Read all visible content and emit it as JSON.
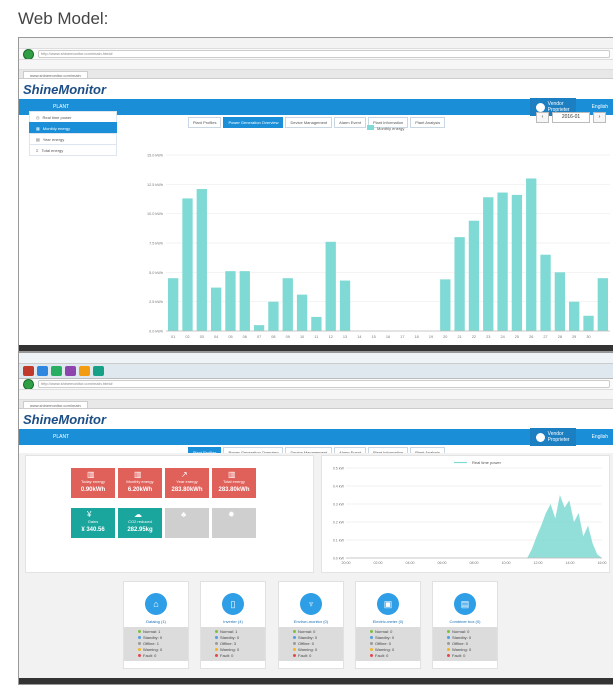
{
  "heading": "Web Model:",
  "colors": {
    "accent": "#1a8fd8",
    "bar": "#7fd9d4",
    "tile_red": "#e0605a",
    "tile_teal": "#1aa59d",
    "tile_gray": "#cfcfcf",
    "normal": "#7fbf3f",
    "standby": "#4e9ee0",
    "offline": "#9a9a9a",
    "warning": "#f0b429",
    "fault": "#e04a4a"
  },
  "brand": {
    "logo": "ShineMonitor",
    "plant": "PLANT",
    "user_line1": "Vendor",
    "user_line2": "Proprieter",
    "lang": "English"
  },
  "browser": {
    "url": "http://www.shinemonitor.com/main.html#",
    "tab": "www.shinemonitor.com/main"
  },
  "nav_tabs": [
    "Plant Profiles",
    "Power Generation Overview",
    "Device Management",
    "Alarm Event",
    "Plant Information",
    "Plant Analysis"
  ],
  "sidebar": [
    {
      "label": "Real time power",
      "icon": "clock-icon"
    },
    {
      "label": "Monthly energy",
      "icon": "calendar-icon"
    },
    {
      "label": "Year energy",
      "icon": "chart-icon"
    },
    {
      "label": "Total energy",
      "icon": "sum-icon"
    }
  ],
  "date_value": "2016-01",
  "chart_data": [
    {
      "type": "bar",
      "legend": "Monthly energy",
      "categories": [
        "01",
        "02",
        "03",
        "04",
        "05",
        "06",
        "07",
        "08",
        "09",
        "10",
        "11",
        "12",
        "13",
        "14",
        "15",
        "16",
        "17",
        "18",
        "19",
        "20",
        "21",
        "22",
        "23",
        "24",
        "25",
        "26",
        "27",
        "28",
        "29",
        "30"
      ],
      "values": [
        4.5,
        11.3,
        12.1,
        3.7,
        5.1,
        5.1,
        0.5,
        2.5,
        4.5,
        3.1,
        1.2,
        7.6,
        4.3,
        0.0,
        0.0,
        0.0,
        0.0,
        0.0,
        0.0,
        4.4,
        8.0,
        9.4,
        11.4,
        11.8,
        11.6,
        13.0,
        6.5,
        5.0,
        2.5,
        1.3,
        4.5
      ],
      "yticks": [
        "0.0 kWh",
        "2.5 kWh",
        "5.0 kWh",
        "7.5 kWh",
        "10.0 kWh",
        "12.5 kWh",
        "15.0 kWh"
      ],
      "ylim": [
        0,
        15
      ]
    },
    {
      "type": "area",
      "legend": "Real time power",
      "xticks": [
        "20:00",
        "02:00",
        "04:00",
        "06:00",
        "08:00",
        "10:00",
        "12:00",
        "14:00",
        "16:00"
      ],
      "yticks": [
        "0.0 kW",
        "0.1 kW",
        "0.2 kW",
        "0.3 kW",
        "0.4 kW",
        "0.5 kW"
      ],
      "ylim": [
        0,
        0.5
      ],
      "x": [
        0,
        1,
        2,
        3,
        4,
        5,
        6,
        7,
        8
      ],
      "y": [
        0,
        0,
        0,
        0,
        0,
        0,
        0.05,
        0.2,
        0
      ]
    }
  ],
  "tiles": [
    {
      "label": "Today energy",
      "value": "0.90kWh",
      "color": "#e0605a",
      "icon": "bar-icon"
    },
    {
      "label": "Monthly energy",
      "value": "6.20kWh",
      "color": "#e0605a",
      "icon": "bar-icon"
    },
    {
      "label": "Year energy",
      "value": "283.80kWh",
      "color": "#e0605a",
      "icon": "trend-icon"
    },
    {
      "label": "Total energy",
      "value": "283.80kWh",
      "color": "#e0605a",
      "icon": "bar-icon"
    },
    {
      "label": "Gains",
      "value": "¥ 340.56",
      "color": "#1aa59d",
      "icon": "yen-icon"
    },
    {
      "label": "CO2 reduced",
      "value": "282.95kg",
      "color": "#1aa59d",
      "icon": "co2-icon"
    },
    {
      "label": "",
      "value": "",
      "color": "#cfcfcf",
      "icon": "tree-icon"
    },
    {
      "label": "",
      "value": "",
      "color": "#cfcfcf",
      "icon": "sun-icon"
    }
  ],
  "devices": [
    {
      "name": "Datalog (1)",
      "icon": "router-icon",
      "status": [
        "Normal: 1",
        "Standby: 0",
        "Offline: 1",
        "Warning: 0",
        "Fault: 0"
      ]
    },
    {
      "name": "Inverter (4)",
      "icon": "inverter-icon",
      "status": [
        "Normal: 1",
        "Standby: 0",
        "Offline: 3",
        "Warning: 0",
        "Fault: 0"
      ]
    },
    {
      "name": "Environ-monitor (0)",
      "icon": "antenna-icon",
      "status": [
        "Normal: 0",
        "Standby: 0",
        "Offline: 0",
        "Warning: 0",
        "Fault: 0"
      ]
    },
    {
      "name": "Electric-meter (0)",
      "icon": "meter-icon",
      "status": [
        "Normal: 0",
        "Standby: 0",
        "Offline: 0",
        "Warning: 0",
        "Fault: 0"
      ]
    },
    {
      "name": "Combiner box (0)",
      "icon": "box-icon",
      "status": [
        "Normal: 0",
        "Standby: 0",
        "Offline: 0",
        "Warning: 0",
        "Fault: 0"
      ]
    }
  ]
}
